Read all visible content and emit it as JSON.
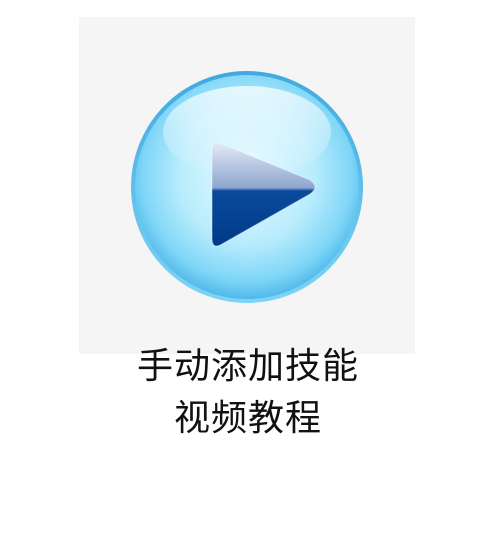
{
  "video_tile": {
    "thumbnail_icon": "play-icon",
    "caption_lines": [
      "手动添加技能",
      "视频教程"
    ]
  },
  "colors": {
    "panel_background": "#f5f5f5",
    "circle_light": "#dff7ff",
    "circle_mid": "#8fdcf8",
    "circle_edge": "#4fb9ea",
    "triangle_dark": "#003c8c",
    "triangle_light": "#c7d3e8",
    "caption_text": "#111111"
  }
}
